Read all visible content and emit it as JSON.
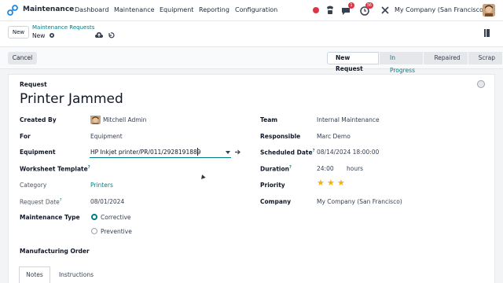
{
  "navbar": {
    "app_name": "Maintenance",
    "menu": [
      "Dashboard",
      "Maintenance",
      "Equipment",
      "Reporting",
      "Configuration"
    ],
    "messages_badge": "1",
    "activity_badge": "36",
    "company": "My Company (San Francisco)"
  },
  "control": {
    "new_label": "New",
    "breadcrumb_parent": "Maintenance Requests",
    "breadcrumb_current": "New"
  },
  "statusbar": {
    "cancel_label": "Cancel",
    "stages": [
      "New Request",
      "In Progress",
      "Repaired",
      "Scrap"
    ],
    "active_stage": "New Request"
  },
  "form": {
    "request_label": "Request",
    "title": "Printer Jammed",
    "left": {
      "created_by_label": "Created By",
      "created_by": "Mitchell Admin",
      "for_label": "For",
      "for_value": "Equipment",
      "equipment_label": "Equipment",
      "equipment_value": "HP Inkjet printer/PR/011/2928191889",
      "worksheet_label": "Worksheet Template",
      "category_label": "Category",
      "category_value": "Printers",
      "request_date_label": "Request Date",
      "request_date": "08/01/2024",
      "maintenance_type_label": "Maintenance Type",
      "type_corrective": "Corrective",
      "type_preventive": "Preventive",
      "manufacturing_order_label": "Manufacturing Order"
    },
    "right": {
      "team_label": "Team",
      "team_value": "Internal Maintenance",
      "responsible_label": "Responsible",
      "responsible_value": "Marc Demo",
      "scheduled_label": "Scheduled Date",
      "scheduled_value": "08/14/2024 18:00:00",
      "duration_label": "Duration",
      "duration_value": "24:00",
      "duration_unit": "hours",
      "priority_label": "Priority",
      "priority_stars": 3,
      "company_label": "Company",
      "company_value": "My Company (San Francisco)"
    },
    "tabs": [
      "Notes",
      "Instructions"
    ]
  },
  "colors": {
    "accent": "#017e84",
    "star": "#f3b20a",
    "badge": "#dc3545"
  }
}
